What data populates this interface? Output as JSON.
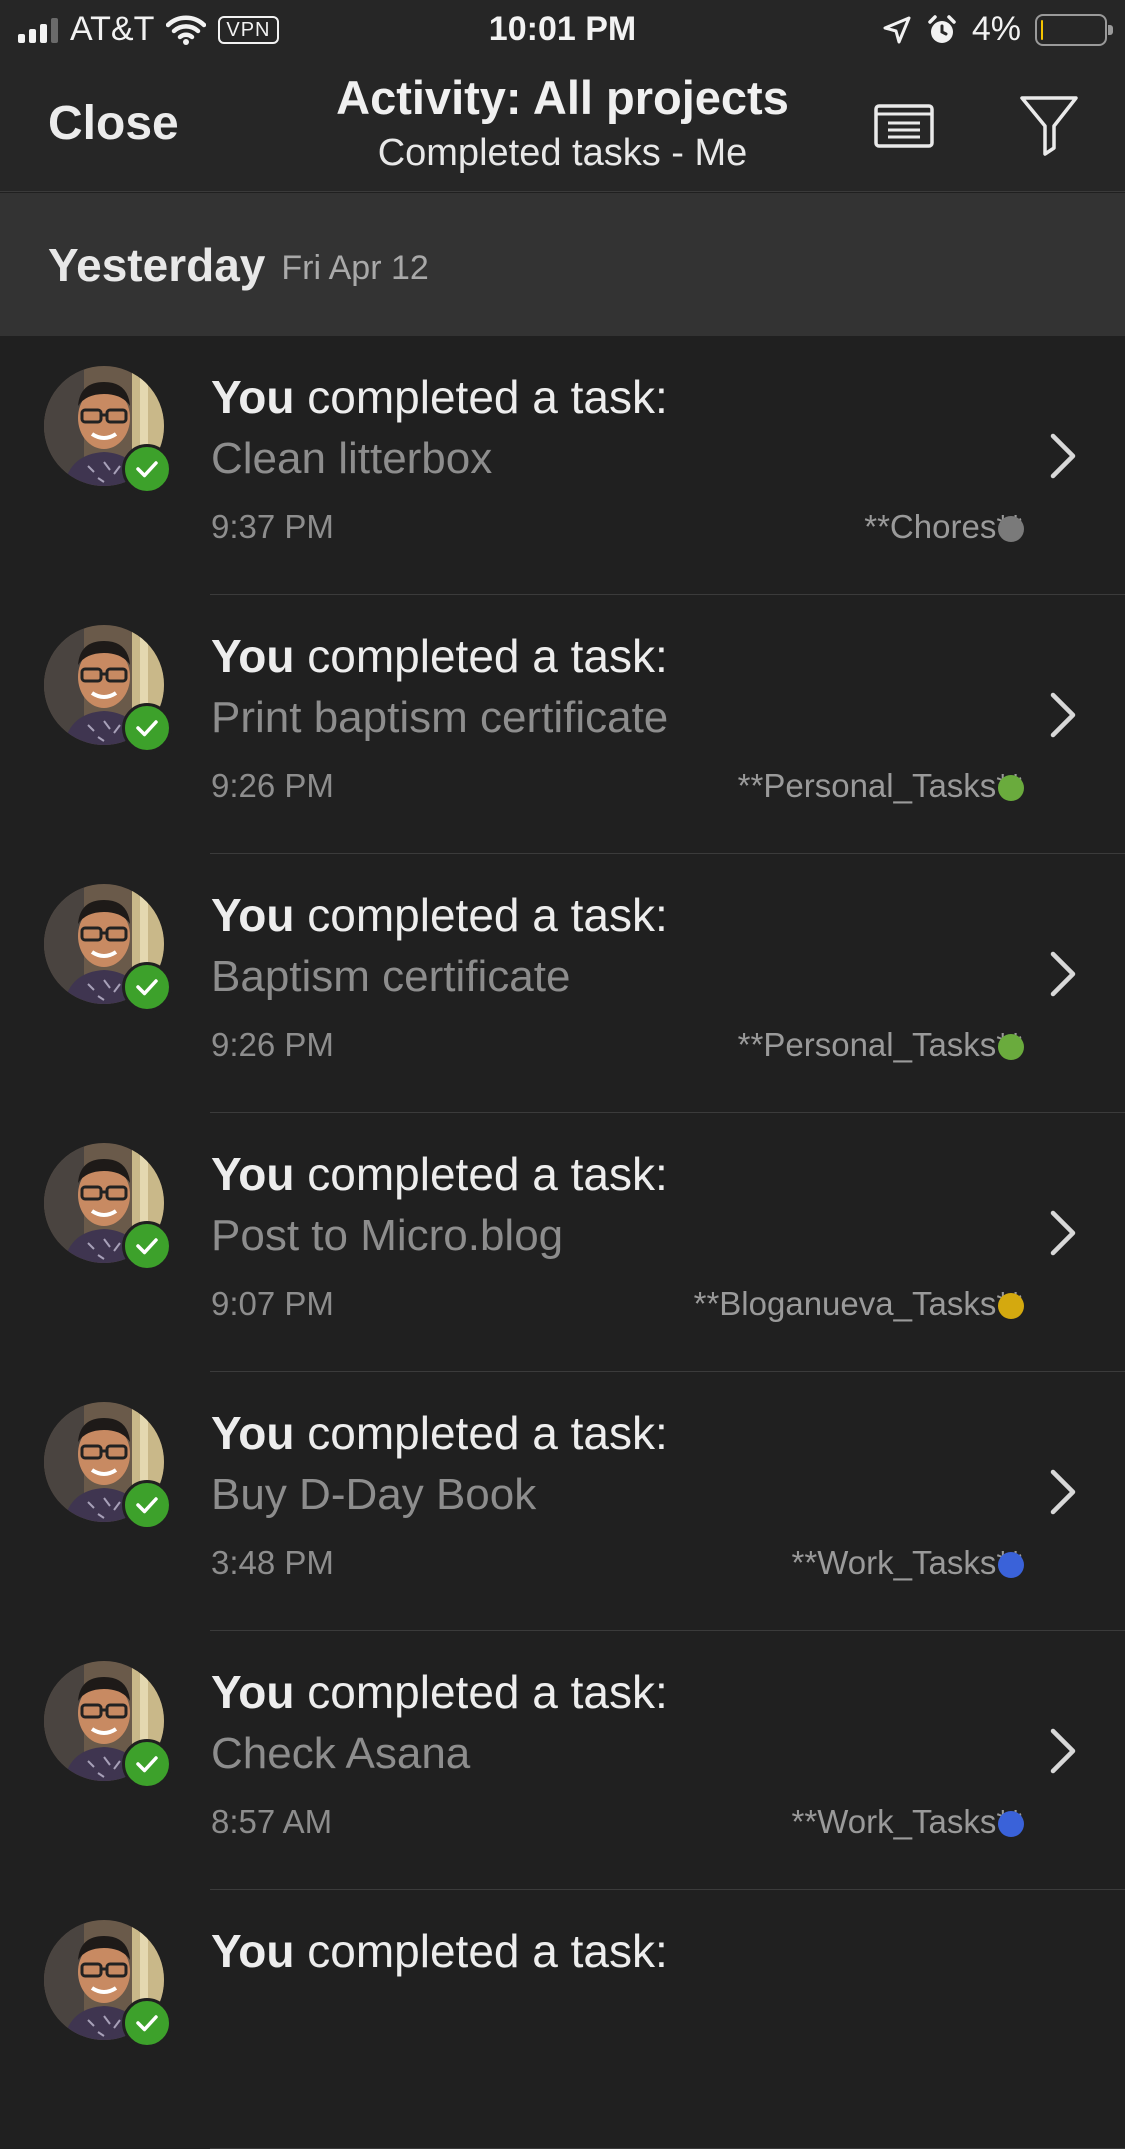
{
  "status_bar": {
    "carrier": "AT&T",
    "vpn": "VPN",
    "time": "10:01 PM",
    "battery": "4%",
    "battery_level": 0.04,
    "icons": [
      "signal-icon",
      "wifi-icon",
      "location-icon",
      "alarm-icon",
      "battery-icon"
    ]
  },
  "header": {
    "close_label": "Close",
    "title": "Activity: All projects",
    "subtitle": "Completed tasks - Me",
    "icons": [
      "list-view-icon",
      "filter-icon"
    ]
  },
  "section": {
    "day": "Yesterday",
    "date": "Fri Apr 12"
  },
  "activity_items": [
    {
      "actor": "You",
      "action": "completed a task:",
      "task": "Clean litterbox",
      "time": "9:37 PM",
      "project": "**Chores**",
      "project_color": "#7a7a7a"
    },
    {
      "actor": "You",
      "action": "completed a task:",
      "task": "Print baptism certificate",
      "time": "9:26 PM",
      "project": "**Personal_Tasks**",
      "project_color": "#6aab3d"
    },
    {
      "actor": "You",
      "action": "completed a task:",
      "task": "Baptism certificate",
      "time": "9:26 PM",
      "project": "**Personal_Tasks**",
      "project_color": "#6aab3d"
    },
    {
      "actor": "You",
      "action": "completed a task:",
      "task": "Post to Micro.blog",
      "time": "9:07 PM",
      "project": "**Bloganueva_Tasks**",
      "project_color": "#d4a90f"
    },
    {
      "actor": "You",
      "action": "completed a task:",
      "task": "Buy D-Day Book",
      "time": "3:48 PM",
      "project": "**Work_Tasks**",
      "project_color": "#3a62d9"
    },
    {
      "actor": "You",
      "action": "completed a task:",
      "task": "Check Asana",
      "time": "8:57 AM",
      "project": "**Work_Tasks**",
      "project_color": "#3a62d9"
    },
    {
      "actor": "You",
      "action": "completed a task:",
      "task": "",
      "time": "",
      "project": "",
      "project_color": "#3a62d9"
    }
  ],
  "colors": {
    "background": "#202020",
    "header": "#262626",
    "section": "#333333",
    "check_green": "#3da12b"
  }
}
